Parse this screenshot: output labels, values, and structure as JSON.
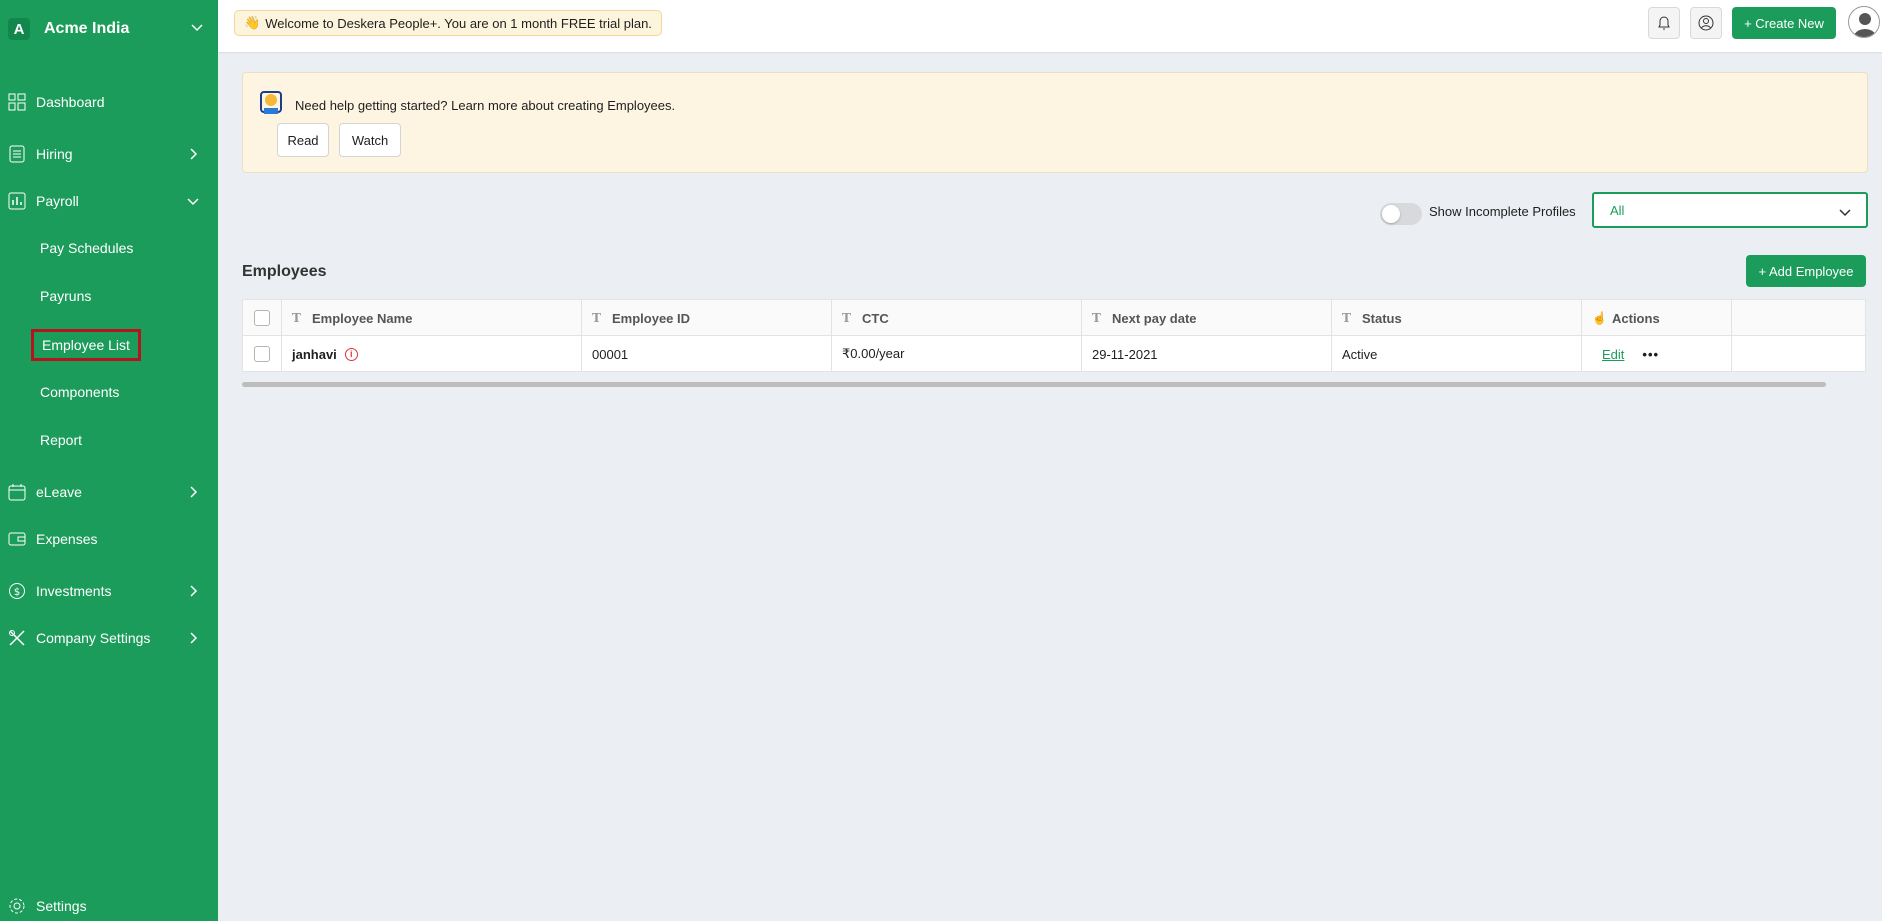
{
  "org": {
    "initial": "A",
    "name": "Acme India"
  },
  "sidebar": {
    "items": [
      {
        "label": "Dashboard",
        "icon": "dashboard-icon"
      },
      {
        "label": "Hiring",
        "icon": "list-icon"
      },
      {
        "label": "Payroll",
        "icon": "chart-icon"
      },
      {
        "label": "eLeave",
        "icon": "calendar-icon"
      },
      {
        "label": "Expenses",
        "icon": "wallet-icon"
      },
      {
        "label": "Investments",
        "icon": "coin-icon"
      },
      {
        "label": "Company Settings",
        "icon": "tools-icon"
      }
    ],
    "payroll_sub": [
      {
        "label": "Pay Schedules"
      },
      {
        "label": "Payruns"
      },
      {
        "label": "Employee List"
      },
      {
        "label": "Components"
      },
      {
        "label": "Report"
      }
    ],
    "settings_label": "Settings"
  },
  "topbar": {
    "trial_text": "Welcome to Deskera People+. You are on 1 month FREE trial plan.",
    "create_label": "+ Create New"
  },
  "help": {
    "text": "Need help getting started? Learn more about creating Employees.",
    "read_label": "Read",
    "watch_label": "Watch"
  },
  "filters": {
    "toggle_label": "Show Incomplete Profiles",
    "select_value": "All"
  },
  "employees": {
    "title": "Employees",
    "add_label": "+ Add Employee",
    "columns": [
      "Employee Name",
      "Employee ID",
      "CTC",
      "Next pay date",
      "Status",
      "Actions"
    ],
    "rows": [
      {
        "name": "janhavi",
        "id": "00001",
        "ctc": "₹0.00/year",
        "next_pay": "29-11-2021",
        "status": "Active",
        "action": "Edit"
      }
    ]
  },
  "colors": {
    "brand": "#1c9c5a",
    "highlight": "#b3141d"
  }
}
